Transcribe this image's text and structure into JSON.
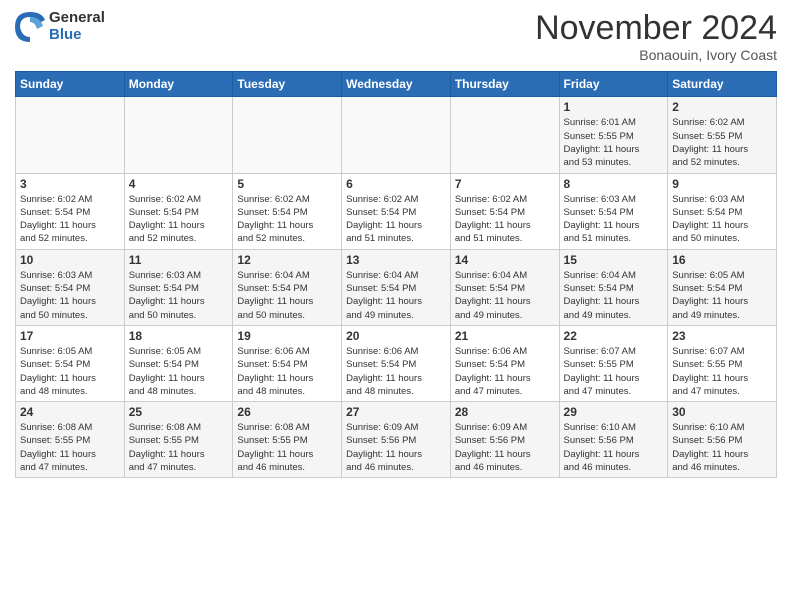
{
  "logo": {
    "general": "General",
    "blue": "Blue"
  },
  "header": {
    "month": "November 2024",
    "location": "Bonaouin, Ivory Coast"
  },
  "weekdays": [
    "Sunday",
    "Monday",
    "Tuesday",
    "Wednesday",
    "Thursday",
    "Friday",
    "Saturday"
  ],
  "weeks": [
    [
      {
        "day": "",
        "info": ""
      },
      {
        "day": "",
        "info": ""
      },
      {
        "day": "",
        "info": ""
      },
      {
        "day": "",
        "info": ""
      },
      {
        "day": "",
        "info": ""
      },
      {
        "day": "1",
        "info": "Sunrise: 6:01 AM\nSunset: 5:55 PM\nDaylight: 11 hours\nand 53 minutes."
      },
      {
        "day": "2",
        "info": "Sunrise: 6:02 AM\nSunset: 5:55 PM\nDaylight: 11 hours\nand 52 minutes."
      }
    ],
    [
      {
        "day": "3",
        "info": "Sunrise: 6:02 AM\nSunset: 5:54 PM\nDaylight: 11 hours\nand 52 minutes."
      },
      {
        "day": "4",
        "info": "Sunrise: 6:02 AM\nSunset: 5:54 PM\nDaylight: 11 hours\nand 52 minutes."
      },
      {
        "day": "5",
        "info": "Sunrise: 6:02 AM\nSunset: 5:54 PM\nDaylight: 11 hours\nand 52 minutes."
      },
      {
        "day": "6",
        "info": "Sunrise: 6:02 AM\nSunset: 5:54 PM\nDaylight: 11 hours\nand 51 minutes."
      },
      {
        "day": "7",
        "info": "Sunrise: 6:02 AM\nSunset: 5:54 PM\nDaylight: 11 hours\nand 51 minutes."
      },
      {
        "day": "8",
        "info": "Sunrise: 6:03 AM\nSunset: 5:54 PM\nDaylight: 11 hours\nand 51 minutes."
      },
      {
        "day": "9",
        "info": "Sunrise: 6:03 AM\nSunset: 5:54 PM\nDaylight: 11 hours\nand 50 minutes."
      }
    ],
    [
      {
        "day": "10",
        "info": "Sunrise: 6:03 AM\nSunset: 5:54 PM\nDaylight: 11 hours\nand 50 minutes."
      },
      {
        "day": "11",
        "info": "Sunrise: 6:03 AM\nSunset: 5:54 PM\nDaylight: 11 hours\nand 50 minutes."
      },
      {
        "day": "12",
        "info": "Sunrise: 6:04 AM\nSunset: 5:54 PM\nDaylight: 11 hours\nand 50 minutes."
      },
      {
        "day": "13",
        "info": "Sunrise: 6:04 AM\nSunset: 5:54 PM\nDaylight: 11 hours\nand 49 minutes."
      },
      {
        "day": "14",
        "info": "Sunrise: 6:04 AM\nSunset: 5:54 PM\nDaylight: 11 hours\nand 49 minutes."
      },
      {
        "day": "15",
        "info": "Sunrise: 6:04 AM\nSunset: 5:54 PM\nDaylight: 11 hours\nand 49 minutes."
      },
      {
        "day": "16",
        "info": "Sunrise: 6:05 AM\nSunset: 5:54 PM\nDaylight: 11 hours\nand 49 minutes."
      }
    ],
    [
      {
        "day": "17",
        "info": "Sunrise: 6:05 AM\nSunset: 5:54 PM\nDaylight: 11 hours\nand 48 minutes."
      },
      {
        "day": "18",
        "info": "Sunrise: 6:05 AM\nSunset: 5:54 PM\nDaylight: 11 hours\nand 48 minutes."
      },
      {
        "day": "19",
        "info": "Sunrise: 6:06 AM\nSunset: 5:54 PM\nDaylight: 11 hours\nand 48 minutes."
      },
      {
        "day": "20",
        "info": "Sunrise: 6:06 AM\nSunset: 5:54 PM\nDaylight: 11 hours\nand 48 minutes."
      },
      {
        "day": "21",
        "info": "Sunrise: 6:06 AM\nSunset: 5:54 PM\nDaylight: 11 hours\nand 47 minutes."
      },
      {
        "day": "22",
        "info": "Sunrise: 6:07 AM\nSunset: 5:55 PM\nDaylight: 11 hours\nand 47 minutes."
      },
      {
        "day": "23",
        "info": "Sunrise: 6:07 AM\nSunset: 5:55 PM\nDaylight: 11 hours\nand 47 minutes."
      }
    ],
    [
      {
        "day": "24",
        "info": "Sunrise: 6:08 AM\nSunset: 5:55 PM\nDaylight: 11 hours\nand 47 minutes."
      },
      {
        "day": "25",
        "info": "Sunrise: 6:08 AM\nSunset: 5:55 PM\nDaylight: 11 hours\nand 47 minutes."
      },
      {
        "day": "26",
        "info": "Sunrise: 6:08 AM\nSunset: 5:55 PM\nDaylight: 11 hours\nand 46 minutes."
      },
      {
        "day": "27",
        "info": "Sunrise: 6:09 AM\nSunset: 5:56 PM\nDaylight: 11 hours\nand 46 minutes."
      },
      {
        "day": "28",
        "info": "Sunrise: 6:09 AM\nSunset: 5:56 PM\nDaylight: 11 hours\nand 46 minutes."
      },
      {
        "day": "29",
        "info": "Sunrise: 6:10 AM\nSunset: 5:56 PM\nDaylight: 11 hours\nand 46 minutes."
      },
      {
        "day": "30",
        "info": "Sunrise: 6:10 AM\nSunset: 5:56 PM\nDaylight: 11 hours\nand 46 minutes."
      }
    ]
  ]
}
